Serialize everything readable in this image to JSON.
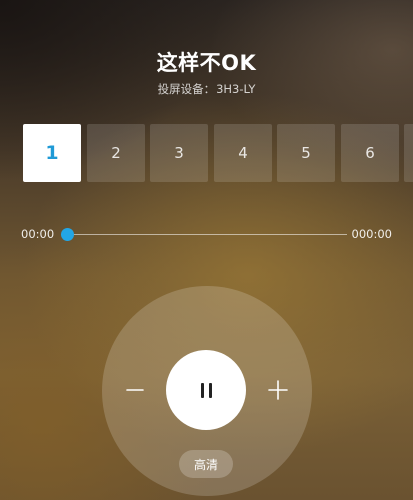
{
  "header": {
    "title": "这样不OK",
    "subtitle_prefix": "投屏设备：",
    "device_name": "3H3-LY"
  },
  "episodes": {
    "items": [
      "1",
      "2",
      "3",
      "4",
      "5",
      "6",
      ""
    ],
    "selected_index": 0
  },
  "progress": {
    "current_time": "00:00",
    "total_time": "000:00",
    "fraction": 0
  },
  "controls": {
    "play_state": "playing",
    "quality_label": "高清",
    "volume_down_icon": "minus-icon",
    "volume_up_icon": "plus-icon",
    "pause_icon": "pause-icon"
  },
  "colors": {
    "accent": "#22a6e6",
    "selected_episode_text": "#1f9ad6",
    "selected_episode_bg": "#ffffff"
  }
}
